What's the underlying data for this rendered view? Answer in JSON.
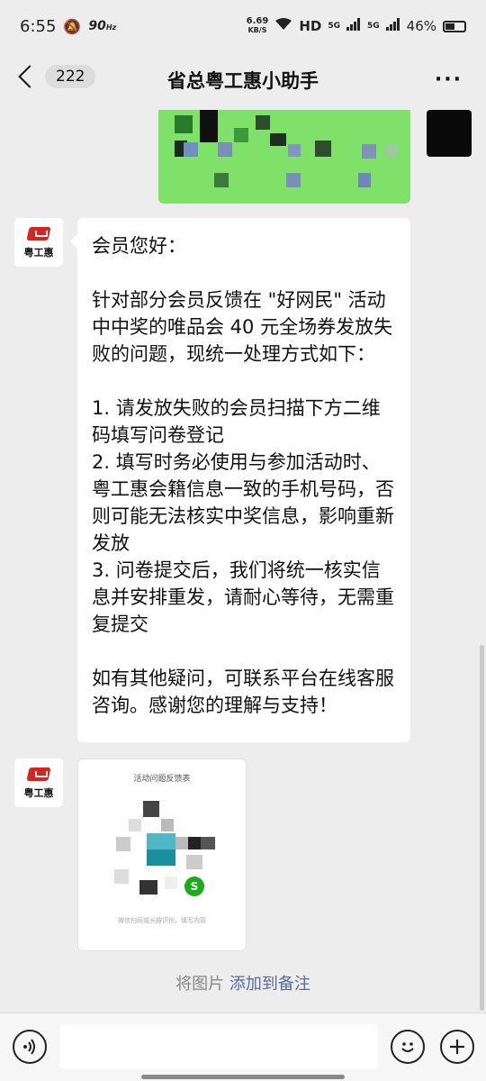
{
  "status": {
    "time": "6:55",
    "refresh_rate": "90",
    "refresh_unit": "Hz",
    "net_speed_value": "6.69",
    "net_speed_unit": "KB/S",
    "hd": "HD",
    "net1": "5G",
    "net2": "5G",
    "battery": "46%"
  },
  "header": {
    "unread_count": "222",
    "title": "省总粤工惠小助手",
    "more": "···"
  },
  "contact": {
    "avatar_label": "粤工惠"
  },
  "message": {
    "text": "会员您好：\n\n针对部分会员反馈在 \"好网民\" 活动中中奖的唯品会 40 元全场券发放失败的问题，现统一处理方式如下：\n\n1. 请发放失败的会员扫描下方二维码填写问卷登记\n2. 填写时务必使用与参加活动时、粤工惠会籍信息一致的手机号码，否则可能无法核实中奖信息，影响重新发放\n3. 问卷提交后，我们将统一核实信息并安排重发，请耐心等待，无需重复提交\n\n如有其他疑问，可联系平台在线客服咨询。感谢您的理解与支持！"
  },
  "image_card": {
    "title": "活动问题反馈表",
    "footer": "微信扫码或长按识别，填写内容"
  },
  "note": {
    "prefix": "将图片",
    "link": "添加到备注"
  },
  "icons": [
    "back-chevron-icon",
    "more-icon",
    "voice-icon",
    "emoji-icon",
    "plus-icon",
    "mini-program-icon"
  ],
  "colors": {
    "accent_green": "#7fe06a",
    "link_blue": "#576b95",
    "brand_red": "#d8231e"
  }
}
